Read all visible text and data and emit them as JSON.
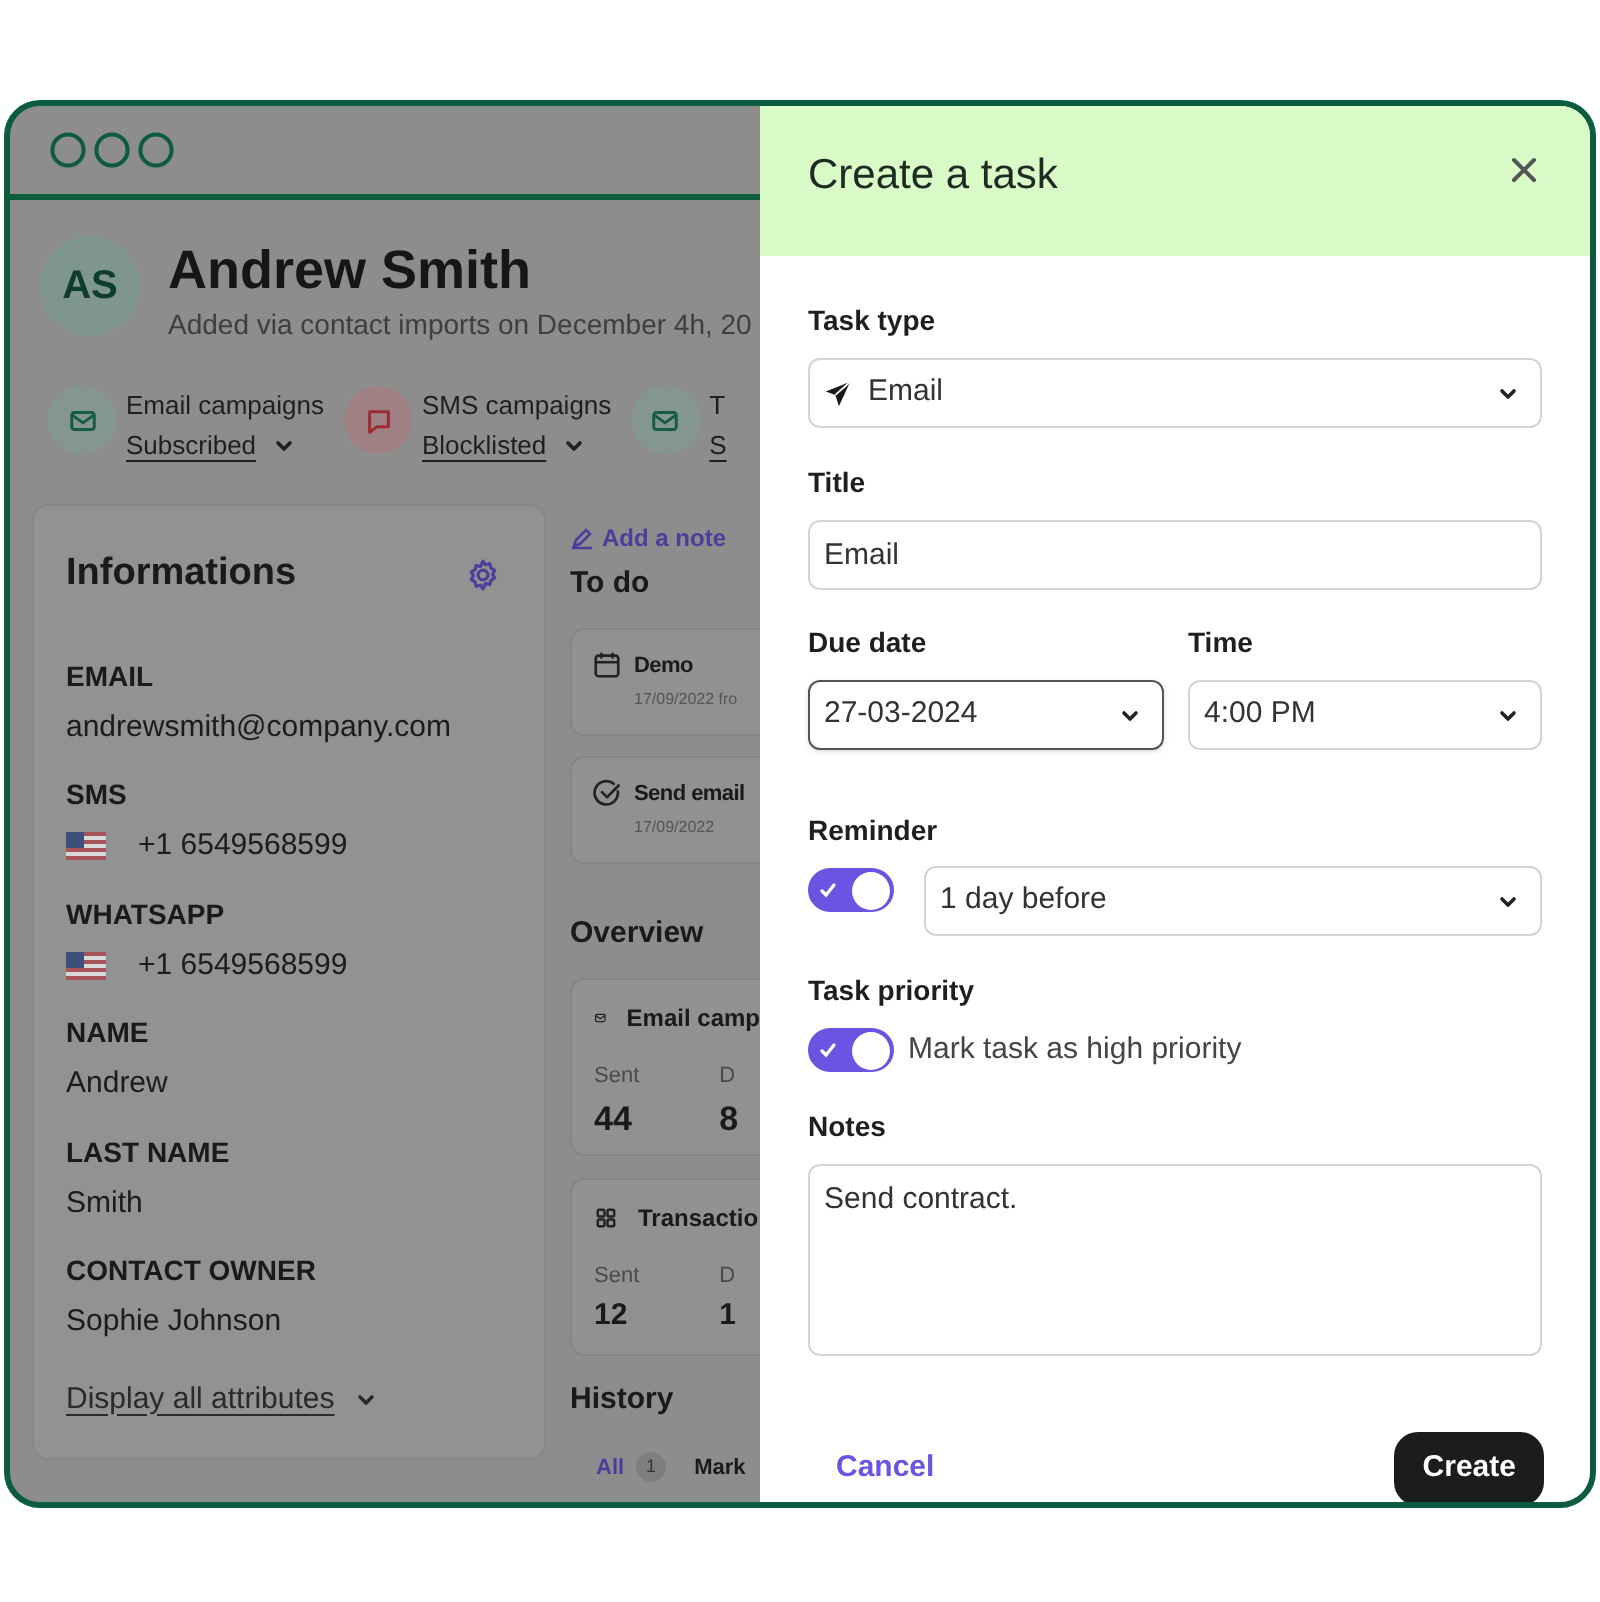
{
  "contact": {
    "initials": "AS",
    "name": "Andrew Smith",
    "subtitle": "Added via contact imports on December 4h, 20"
  },
  "channels": [
    {
      "label": "Email campaigns",
      "status": "Subscribed",
      "kind": "email"
    },
    {
      "label": "SMS campaigns",
      "status": "Blocklisted",
      "kind": "sms"
    },
    {
      "label": "T",
      "status": "S",
      "kind": "email"
    }
  ],
  "informations": {
    "title": "Informations",
    "fields": [
      {
        "label": "EMAIL",
        "value": "andrewsmith@company.com",
        "kind": "text"
      },
      {
        "label": "SMS",
        "value": "+1 6549568599",
        "kind": "phone"
      },
      {
        "label": "WHATSAPP",
        "value": "+1 6549568599",
        "kind": "phone"
      },
      {
        "label": "NAME",
        "value": "Andrew",
        "kind": "text"
      },
      {
        "label": "LAST NAME",
        "value": "Smith",
        "kind": "text"
      },
      {
        "label": "CONTACT OWNER",
        "value": "Sophie Johnson",
        "kind": "text"
      }
    ],
    "more_link": "Display all attributes"
  },
  "activity": {
    "add_note": "Add a note",
    "todo_title": "To do",
    "todos": [
      {
        "title": "Demo",
        "meta": "17/09/2022 fro",
        "kind": "event"
      },
      {
        "title": "Send email",
        "meta": "17/09/2022",
        "kind": "done"
      }
    ],
    "overview_title": "Overview",
    "overview": [
      {
        "title": "Email camp",
        "kind": "email",
        "stats": [
          {
            "label": "Sent",
            "value": "44"
          },
          {
            "label": "D",
            "value": "8"
          }
        ]
      },
      {
        "title": "Transactio",
        "kind": "grid",
        "stats": [
          {
            "label": "Sent",
            "value": "12"
          },
          {
            "label": "D",
            "value": "1"
          }
        ]
      }
    ],
    "history_title": "History",
    "history_tabs": [
      {
        "label": "All",
        "count": "1",
        "selected": true
      },
      {
        "label": "Mark",
        "selected": false
      }
    ]
  },
  "task_panel": {
    "title": "Create a task",
    "task_type": {
      "label": "Task type",
      "value": "Email"
    },
    "title_field": {
      "label": "Title",
      "value": "Email"
    },
    "due_date": {
      "label": "Due date",
      "value": "27-03-2024",
      "focused": true
    },
    "time": {
      "label": "Time",
      "value": "4:00 PM",
      "focused": false
    },
    "reminder": {
      "label": "Reminder",
      "on": true,
      "value": "1 day before"
    },
    "priority": {
      "label": "Task priority",
      "on": true,
      "text": "Mark task as high priority"
    },
    "notes": {
      "label": "Notes",
      "value": "Send contract."
    },
    "buttons": {
      "cancel": "Cancel",
      "create": "Create"
    }
  }
}
